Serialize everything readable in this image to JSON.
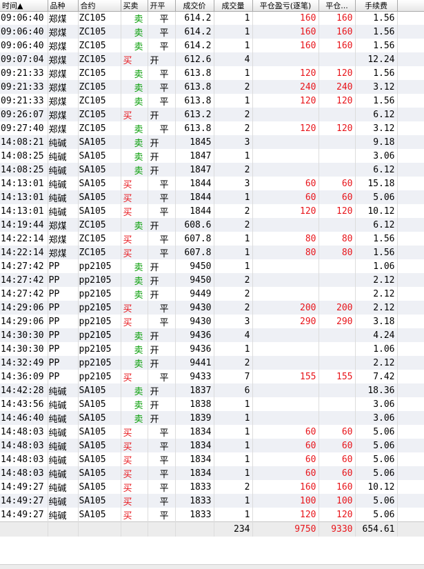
{
  "columns": [
    "时间▲",
    "品种",
    "合约",
    "买卖",
    "开平",
    "成交价",
    "成交量",
    "平仓盈亏(逐笔)",
    "平仓...",
    "手续费"
  ],
  "colors": {
    "buy": "#e8141a",
    "sell": "#009b00",
    "profit": "#e8141a"
  },
  "rows": [
    {
      "time": "09:06:40",
      "product": "郑煤",
      "contract": "ZC105",
      "side": "卖",
      "open_close": "平",
      "price": "614.2",
      "qty": "1",
      "pnl": "160",
      "pnl2": "160",
      "fee": "1.56"
    },
    {
      "time": "09:06:40",
      "product": "郑煤",
      "contract": "ZC105",
      "side": "卖",
      "open_close": "平",
      "price": "614.2",
      "qty": "1",
      "pnl": "160",
      "pnl2": "160",
      "fee": "1.56"
    },
    {
      "time": "09:06:40",
      "product": "郑煤",
      "contract": "ZC105",
      "side": "卖",
      "open_close": "平",
      "price": "614.2",
      "qty": "1",
      "pnl": "160",
      "pnl2": "160",
      "fee": "1.56"
    },
    {
      "time": "09:07:04",
      "product": "郑煤",
      "contract": "ZC105",
      "side": "买",
      "open_close": "开",
      "price": "612.6",
      "qty": "4",
      "pnl": "",
      "pnl2": "",
      "fee": "12.24"
    },
    {
      "time": "09:21:33",
      "product": "郑煤",
      "contract": "ZC105",
      "side": "卖",
      "open_close": "平",
      "price": "613.8",
      "qty": "1",
      "pnl": "120",
      "pnl2": "120",
      "fee": "1.56"
    },
    {
      "time": "09:21:33",
      "product": "郑煤",
      "contract": "ZC105",
      "side": "卖",
      "open_close": "平",
      "price": "613.8",
      "qty": "2",
      "pnl": "240",
      "pnl2": "240",
      "fee": "3.12"
    },
    {
      "time": "09:21:33",
      "product": "郑煤",
      "contract": "ZC105",
      "side": "卖",
      "open_close": "平",
      "price": "613.8",
      "qty": "1",
      "pnl": "120",
      "pnl2": "120",
      "fee": "1.56"
    },
    {
      "time": "09:26:07",
      "product": "郑煤",
      "contract": "ZC105",
      "side": "买",
      "open_close": "开",
      "price": "613.2",
      "qty": "2",
      "pnl": "",
      "pnl2": "",
      "fee": "6.12"
    },
    {
      "time": "09:27:40",
      "product": "郑煤",
      "contract": "ZC105",
      "side": "卖",
      "open_close": "平",
      "price": "613.8",
      "qty": "2",
      "pnl": "120",
      "pnl2": "120",
      "fee": "3.12"
    },
    {
      "time": "14:08:21",
      "product": "纯碱",
      "contract": "SA105",
      "side": "卖",
      "open_close": "开",
      "price": "1845",
      "qty": "3",
      "pnl": "",
      "pnl2": "",
      "fee": "9.18"
    },
    {
      "time": "14:08:25",
      "product": "纯碱",
      "contract": "SA105",
      "side": "卖",
      "open_close": "开",
      "price": "1847",
      "qty": "1",
      "pnl": "",
      "pnl2": "",
      "fee": "3.06"
    },
    {
      "time": "14:08:25",
      "product": "纯碱",
      "contract": "SA105",
      "side": "卖",
      "open_close": "开",
      "price": "1847",
      "qty": "2",
      "pnl": "",
      "pnl2": "",
      "fee": "6.12"
    },
    {
      "time": "14:13:01",
      "product": "纯碱",
      "contract": "SA105",
      "side": "买",
      "open_close": "平",
      "price": "1844",
      "qty": "3",
      "pnl": "60",
      "pnl2": "60",
      "fee": "15.18"
    },
    {
      "time": "14:13:01",
      "product": "纯碱",
      "contract": "SA105",
      "side": "买",
      "open_close": "平",
      "price": "1844",
      "qty": "1",
      "pnl": "60",
      "pnl2": "60",
      "fee": "5.06"
    },
    {
      "time": "14:13:01",
      "product": "纯碱",
      "contract": "SA105",
      "side": "买",
      "open_close": "平",
      "price": "1844",
      "qty": "2",
      "pnl": "120",
      "pnl2": "120",
      "fee": "10.12"
    },
    {
      "time": "14:19:44",
      "product": "郑煤",
      "contract": "ZC105",
      "side": "卖",
      "open_close": "开",
      "price": "608.6",
      "qty": "2",
      "pnl": "",
      "pnl2": "",
      "fee": "6.12"
    },
    {
      "time": "14:22:14",
      "product": "郑煤",
      "contract": "ZC105",
      "side": "买",
      "open_close": "平",
      "price": "607.8",
      "qty": "1",
      "pnl": "80",
      "pnl2": "80",
      "fee": "1.56"
    },
    {
      "time": "14:22:14",
      "product": "郑煤",
      "contract": "ZC105",
      "side": "买",
      "open_close": "平",
      "price": "607.8",
      "qty": "1",
      "pnl": "80",
      "pnl2": "80",
      "fee": "1.56"
    },
    {
      "time": "14:27:42",
      "product": "PP",
      "contract": "pp2105",
      "side": "卖",
      "open_close": "开",
      "price": "9450",
      "qty": "1",
      "pnl": "",
      "pnl2": "",
      "fee": "1.06"
    },
    {
      "time": "14:27:42",
      "product": "PP",
      "contract": "pp2105",
      "side": "卖",
      "open_close": "开",
      "price": "9450",
      "qty": "2",
      "pnl": "",
      "pnl2": "",
      "fee": "2.12"
    },
    {
      "time": "14:27:42",
      "product": "PP",
      "contract": "pp2105",
      "side": "卖",
      "open_close": "开",
      "price": "9449",
      "qty": "2",
      "pnl": "",
      "pnl2": "",
      "fee": "2.12"
    },
    {
      "time": "14:29:06",
      "product": "PP",
      "contract": "pp2105",
      "side": "买",
      "open_close": "平",
      "price": "9430",
      "qty": "2",
      "pnl": "200",
      "pnl2": "200",
      "fee": "2.12"
    },
    {
      "time": "14:29:06",
      "product": "PP",
      "contract": "pp2105",
      "side": "买",
      "open_close": "平",
      "price": "9430",
      "qty": "3",
      "pnl": "290",
      "pnl2": "290",
      "fee": "3.18"
    },
    {
      "time": "14:30:30",
      "product": "PP",
      "contract": "pp2105",
      "side": "卖",
      "open_close": "开",
      "price": "9436",
      "qty": "4",
      "pnl": "",
      "pnl2": "",
      "fee": "4.24"
    },
    {
      "time": "14:30:30",
      "product": "PP",
      "contract": "pp2105",
      "side": "卖",
      "open_close": "开",
      "price": "9436",
      "qty": "1",
      "pnl": "",
      "pnl2": "",
      "fee": "1.06"
    },
    {
      "time": "14:32:49",
      "product": "PP",
      "contract": "pp2105",
      "side": "卖",
      "open_close": "开",
      "price": "9441",
      "qty": "2",
      "pnl": "",
      "pnl2": "",
      "fee": "2.12"
    },
    {
      "time": "14:36:09",
      "product": "PP",
      "contract": "pp2105",
      "side": "买",
      "open_close": "平",
      "price": "9433",
      "qty": "7",
      "pnl": "155",
      "pnl2": "155",
      "fee": "7.42"
    },
    {
      "time": "14:42:28",
      "product": "纯碱",
      "contract": "SA105",
      "side": "卖",
      "open_close": "开",
      "price": "1837",
      "qty": "6",
      "pnl": "",
      "pnl2": "",
      "fee": "18.36"
    },
    {
      "time": "14:43:56",
      "product": "纯碱",
      "contract": "SA105",
      "side": "卖",
      "open_close": "开",
      "price": "1838",
      "qty": "1",
      "pnl": "",
      "pnl2": "",
      "fee": "3.06"
    },
    {
      "time": "14:46:40",
      "product": "纯碱",
      "contract": "SA105",
      "side": "卖",
      "open_close": "开",
      "price": "1839",
      "qty": "1",
      "pnl": "",
      "pnl2": "",
      "fee": "3.06"
    },
    {
      "time": "14:48:03",
      "product": "纯碱",
      "contract": "SA105",
      "side": "买",
      "open_close": "平",
      "price": "1834",
      "qty": "1",
      "pnl": "60",
      "pnl2": "60",
      "fee": "5.06"
    },
    {
      "time": "14:48:03",
      "product": "纯碱",
      "contract": "SA105",
      "side": "买",
      "open_close": "平",
      "price": "1834",
      "qty": "1",
      "pnl": "60",
      "pnl2": "60",
      "fee": "5.06"
    },
    {
      "time": "14:48:03",
      "product": "纯碱",
      "contract": "SA105",
      "side": "买",
      "open_close": "平",
      "price": "1834",
      "qty": "1",
      "pnl": "60",
      "pnl2": "60",
      "fee": "5.06"
    },
    {
      "time": "14:48:03",
      "product": "纯碱",
      "contract": "SA105",
      "side": "买",
      "open_close": "平",
      "price": "1834",
      "qty": "1",
      "pnl": "60",
      "pnl2": "60",
      "fee": "5.06"
    },
    {
      "time": "14:49:27",
      "product": "纯碱",
      "contract": "SA105",
      "side": "买",
      "open_close": "平",
      "price": "1833",
      "qty": "2",
      "pnl": "160",
      "pnl2": "160",
      "fee": "10.12"
    },
    {
      "time": "14:49:27",
      "product": "纯碱",
      "contract": "SA105",
      "side": "买",
      "open_close": "平",
      "price": "1833",
      "qty": "1",
      "pnl": "100",
      "pnl2": "100",
      "fee": "5.06"
    },
    {
      "time": "14:49:27",
      "product": "纯碱",
      "contract": "SA105",
      "side": "买",
      "open_close": "平",
      "price": "1833",
      "qty": "1",
      "pnl": "120",
      "pnl2": "120",
      "fee": "5.06"
    }
  ],
  "totals": {
    "qty": "234",
    "pnl": "9750",
    "pnl2": "9330",
    "fee": "654.61"
  }
}
